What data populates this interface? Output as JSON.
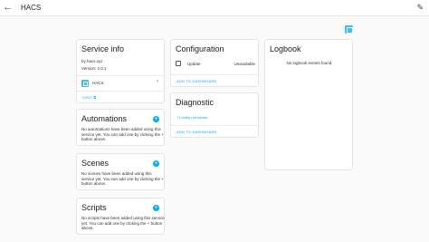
{
  "topbar": {
    "back_icon": "arrow-left-icon",
    "title": "HACS",
    "edit_icon": "pencil-icon"
  },
  "header_icon": "hacs-logo-icon",
  "service_info": {
    "title": "Service info",
    "by": "by hacs.xyz",
    "version": "Version: 2.0.1",
    "device": "HACS",
    "visit": "VISIT"
  },
  "automations": {
    "title": "Automations",
    "description": "No automations have been added using this service yet. You can add one by clicking the + button above."
  },
  "scenes": {
    "title": "Scenes",
    "description": "No scenes have been added using this service yet. You can add one by clicking the + button above."
  },
  "scripts": {
    "title": "Scripts",
    "description": "No scripts have been added using this service yet. You can add one by clicking the + button above."
  },
  "configuration": {
    "title": "Configuration",
    "entity_name": "Update",
    "entity_state": "Unavailable",
    "add_to_dashboard": "ADD TO DASHBOARD"
  },
  "diagnostic": {
    "title": "Diagnostic",
    "hidden_note": "+1 entity not shown",
    "add_to_dashboard": "ADD TO DASHBOARD"
  },
  "logbook": {
    "title": "Logbook",
    "empty": "No logbook events found."
  },
  "colors": {
    "accent": "#03a9f4",
    "hacs_brand": "#41bdf5",
    "background": "#fafafa"
  }
}
